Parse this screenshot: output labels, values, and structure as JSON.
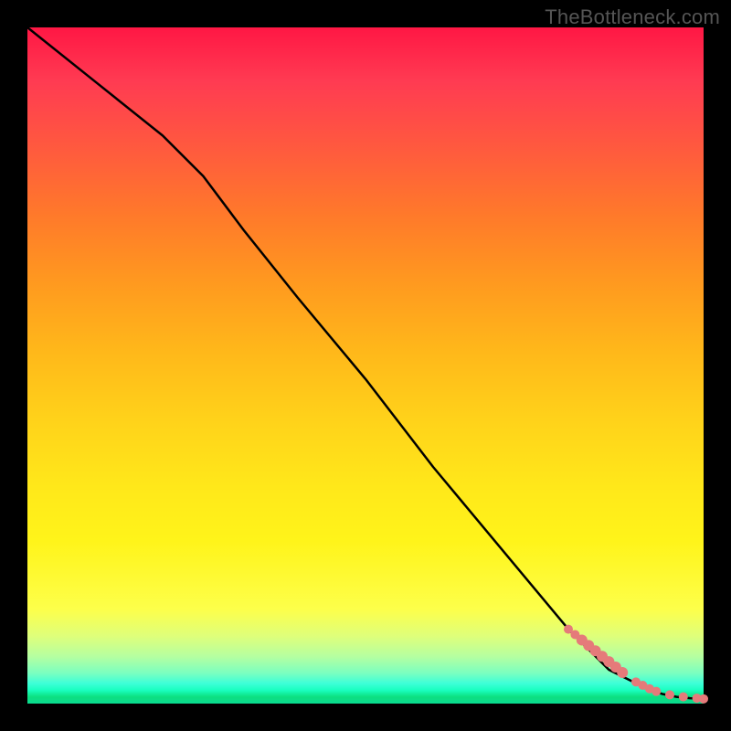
{
  "watermark": "TheBottleneck.com",
  "chart_data": {
    "type": "line",
    "title": "",
    "xlabel": "",
    "ylabel": "",
    "xlim": [
      0,
      100
    ],
    "ylim": [
      0,
      100
    ],
    "grid": false,
    "series": [
      {
        "name": "curve",
        "x": [
          0,
          10,
          20,
          26,
          32,
          40,
          50,
          60,
          70,
          80,
          86,
          88,
          90,
          91,
          92,
          94,
          96,
          98,
          100
        ],
        "y": [
          100,
          92,
          84,
          78,
          70,
          60,
          48,
          35,
          23,
          11,
          5,
          4,
          3,
          2.5,
          2,
          1.4,
          1,
          0.8,
          0.7
        ]
      }
    ],
    "scatter": {
      "name": "highlight-points",
      "x": [
        80,
        81,
        82,
        83,
        84,
        85,
        86,
        87,
        88,
        90,
        91,
        92,
        93,
        95,
        97,
        99,
        100
      ],
      "y": [
        11,
        10.2,
        9.4,
        8.6,
        7.8,
        7,
        6.2,
        5.4,
        4.6,
        3.2,
        2.7,
        2.2,
        1.8,
        1.3,
        1,
        0.8,
        0.7
      ]
    },
    "colors": {
      "curve": "#000000",
      "points": "#e57a7a",
      "gradient_top": "#ff1744",
      "gradient_mid": "#ffe81a",
      "gradient_bottom": "#0ada90"
    }
  }
}
